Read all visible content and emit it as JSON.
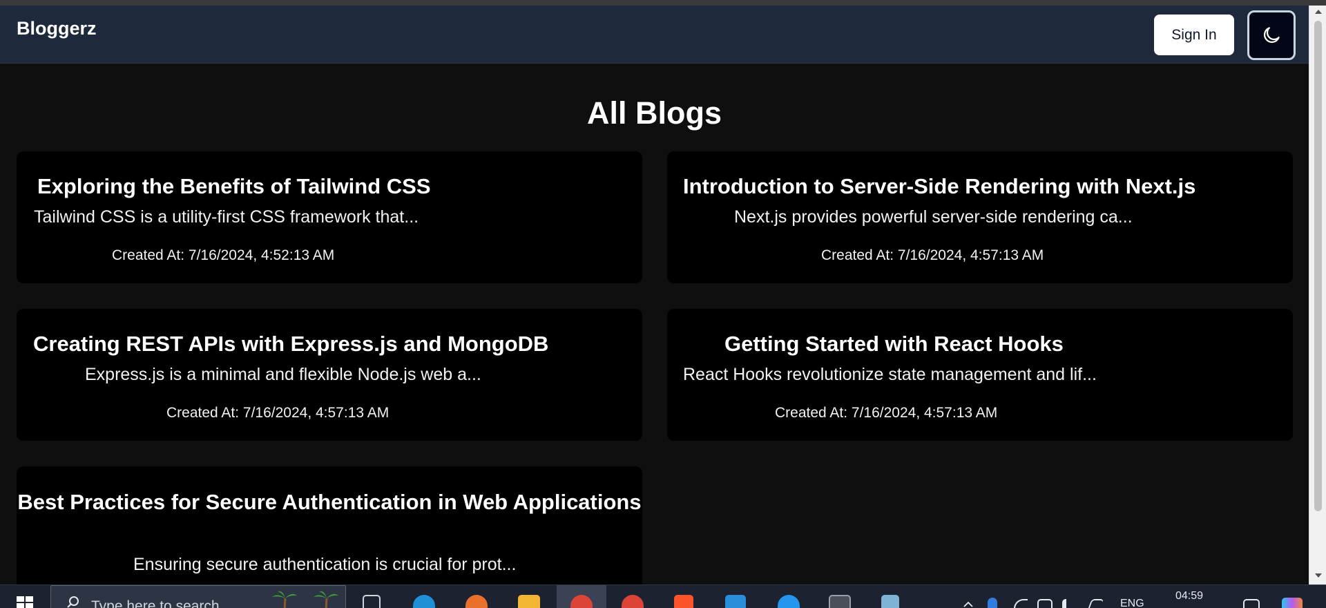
{
  "navbar": {
    "brand": "Bloggerz",
    "sign_in_label": "Sign In",
    "theme_toggle_icon": "moon-icon"
  },
  "page_title": "All Blogs",
  "blogs": [
    {
      "title": "Exploring the Benefits of Tailwind CSS",
      "excerpt": "Tailwind CSS is a utility-first CSS framework that...",
      "created_at": "Created At: 7/16/2024, 4:52:13 AM"
    },
    {
      "title": "Introduction to Server-Side Rendering with Next.js",
      "excerpt": "Next.js provides powerful server-side rendering ca...",
      "created_at": "Created At: 7/16/2024, 4:57:13 AM"
    },
    {
      "title": "Creating REST APIs with Express.js and MongoDB",
      "excerpt": "Express.js is a minimal and flexible Node.js web a...",
      "created_at": "Created At: 7/16/2024, 4:57:13 AM"
    },
    {
      "title": "Getting Started with React Hooks",
      "excerpt": "React Hooks revolutionize state management and lif...",
      "created_at": "Created At: 7/16/2024, 4:57:13 AM"
    },
    {
      "title": "Best Practices for Secure Authentication in Web Applications",
      "excerpt": "Ensuring secure authentication is crucial for prot..."
    }
  ],
  "taskbar": {
    "search_placeholder": "Type here to search",
    "language": "ENG",
    "time": "04:59",
    "pinned_icons": [
      "task-view-icon",
      "edge-icon",
      "firefox-icon",
      "file-explorer-icon",
      "chrome-icon",
      "chrome-icon",
      "brave-icon",
      "vscode-icon",
      "docker-icon",
      "terminal-icon",
      "app-icon"
    ]
  },
  "colors": {
    "page_bg": "#0f0f0f",
    "navbar_bg": "#1e293b",
    "card_bg": "#000000",
    "text": "#ffffff"
  }
}
